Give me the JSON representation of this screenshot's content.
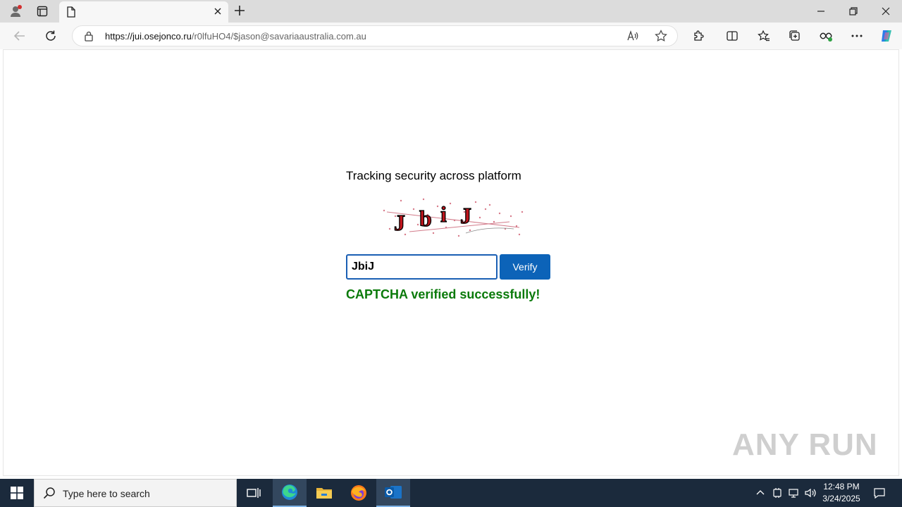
{
  "browser": {
    "tab_title": "",
    "url_host": "https://jui.osejonco.ru",
    "url_path": "/r0lfuHO4/$jason@savariaaustralia.com.au"
  },
  "page": {
    "heading": "Tracking security across platform",
    "captcha_text": [
      "J",
      "b",
      "i",
      "J"
    ],
    "captcha_input_value": "JbiJ",
    "verify_label": "Verify",
    "success_message": "CAPTCHA verified successfully!"
  },
  "watermark": "ANY RUN",
  "taskbar": {
    "search_placeholder": "Type here to search",
    "time": "12:48 PM",
    "date": "3/24/2025"
  },
  "colors": {
    "verify_button": "#0c63b8",
    "success_text": "#0a7a0a",
    "input_border": "#1a5fb4",
    "captcha_glyph": "#c0141c"
  }
}
